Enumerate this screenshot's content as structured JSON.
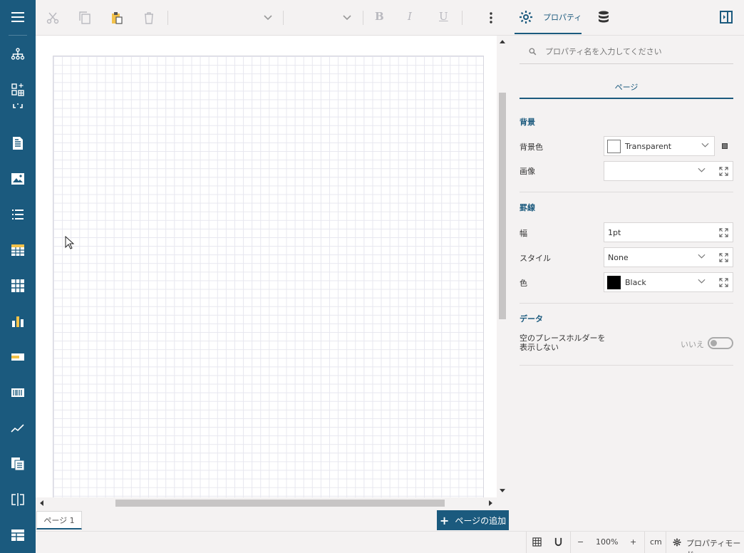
{
  "toolbar": {
    "bold_label": "B",
    "italic_label": "I",
    "underline_label": "U"
  },
  "panel_tabs": {
    "properties_label": "プロパティ"
  },
  "properties": {
    "search_placeholder": "プロパティ名を入力してください",
    "category_tab": "ページ",
    "sections": {
      "background": "背景",
      "border": "罫線",
      "data": "データ"
    },
    "bg_color_label": "背景色",
    "bg_color_value": "Transparent",
    "image_label": "画像",
    "image_value": "",
    "width_label": "幅",
    "width_value": "1pt",
    "style_label": "スタイル",
    "style_value": "None",
    "color_label": "色",
    "color_value": "Black",
    "placeholder_label_line1": "空のプレースホルダーを",
    "placeholder_label_line2": "表示しない",
    "placeholder_value": "いいえ"
  },
  "pagebar": {
    "page_tab_label": "ページ 1",
    "add_page_label": "ページの追加"
  },
  "statusbar": {
    "zoom_minus": "−",
    "zoom_value": "100%",
    "zoom_plus": "+",
    "unit": "cm",
    "mode_label": "プロパティモード"
  },
  "colors": {
    "accent": "#1b5a7e",
    "sidebar": "#1b5a7e",
    "panel_bg": "#f4f2f2",
    "grid": "#e7e7ef"
  }
}
